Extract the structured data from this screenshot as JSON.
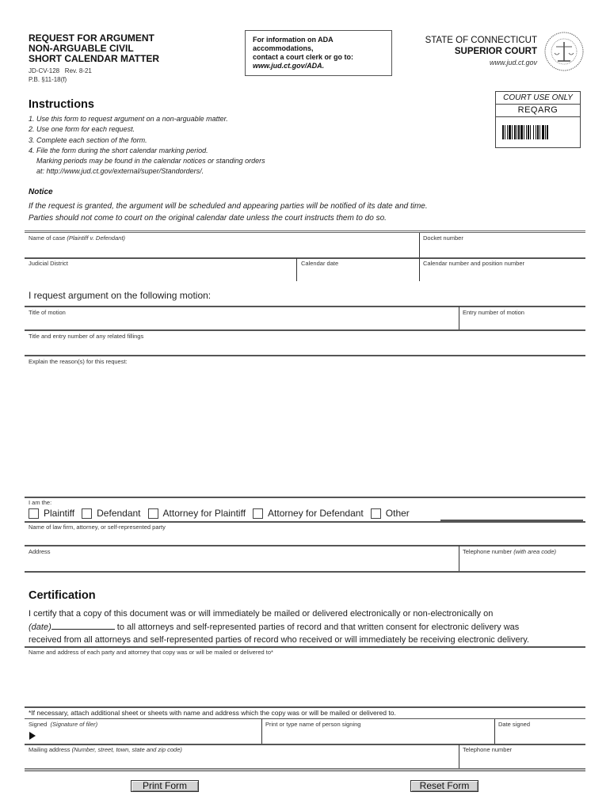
{
  "header": {
    "title_lines": [
      "REQUEST FOR ARGUMENT",
      "NON-ARGUABLE CIVIL",
      "SHORT CALENDAR MATTER"
    ],
    "form_number": "JD-CV-128   Rev. 8-21",
    "practice_book": "P.B. §11-18(f)",
    "ada_lines": [
      "For information on ADA",
      "accommodations,",
      "contact a court clerk or go to:"
    ],
    "ada_link": "www.jud.ct.gov/ADA.",
    "state": "STATE OF CONNECTICUT",
    "court": "SUPERIOR COURT",
    "website": "www.jud.ct.gov",
    "seal_icon": "state-judicial-seal"
  },
  "court_use": {
    "label": "COURT USE ONLY",
    "code": "REQARG",
    "barcode_icon": "barcode"
  },
  "instructions": {
    "heading": "Instructions",
    "items": [
      "1. Use this form to request argument on a non-arguable matter.",
      "2. Use one form for each request.",
      "3. Complete each section of the form.",
      "4. File the form during the short calendar marking period.",
      "    Marking periods may be found in the calendar notices or standing orders",
      "    at: http://www.jud.ct.gov/external/super/Standorders/."
    ]
  },
  "notice": {
    "heading": "Notice",
    "lines": [
      "If the request is granted, the argument will be scheduled and appearing parties will be notified of its date and time.",
      "Parties should not come to court on the original calendar date unless the court instructs them to do so."
    ]
  },
  "case_fields": {
    "name_of_case": "Name of case",
    "name_of_case_hint": "(Plaintiff v. Defendant)",
    "docket_number": "Docket number",
    "judicial_district": "Judicial District",
    "calendar_date": "Calendar date",
    "calendar_number": "Calendar number and position number"
  },
  "motion": {
    "heading": "I request argument on the following motion:",
    "title_of_motion": "Title of motion",
    "entry_number": "Entry number of motion",
    "related_filings": "Title and entry number of any related fillings",
    "explain": "Explain the reason(s) for this request:"
  },
  "party": {
    "i_am_the": "I am the:",
    "options": [
      "Plaintiff",
      "Defendant",
      "Attorney for Plaintiff",
      "Attorney for Defendant",
      "Other"
    ],
    "name_label": "Name of law firm, attorney, or self-represented party",
    "address_label": "Address",
    "telephone_label": "Telephone number",
    "telephone_hint": "(with area code)"
  },
  "certification": {
    "heading": "Certification",
    "line1": "I certify that a copy of this document was or will immediately be mailed or delivered electronically or non-electronically on",
    "date_hint": "(date)",
    "line2": " to all attorneys and self-represented parties of record and that written consent for electronic delivery was",
    "line3": "received from all attorneys and self-represented parties of record who received or will immediately be receiving electronic delivery.",
    "name_address_label": "Name and address of each party and attorney that copy was or will be mailed or delivered to*",
    "footnote": "*If necessary, attach additional sheet or sheets with name and address which the copy was or will be mailed or delivered to.",
    "signed_label": "Signed",
    "signed_hint": "(Signature of filer)",
    "print_name_label": "Print or type name of person signing",
    "date_signed_label": "Date signed",
    "mailing_label": "Mailing address",
    "mailing_hint": "(Number, street, town, state and zip code)",
    "telephone_label": "Telephone number"
  },
  "buttons": {
    "print": "Print Form",
    "reset": "Reset Form"
  }
}
